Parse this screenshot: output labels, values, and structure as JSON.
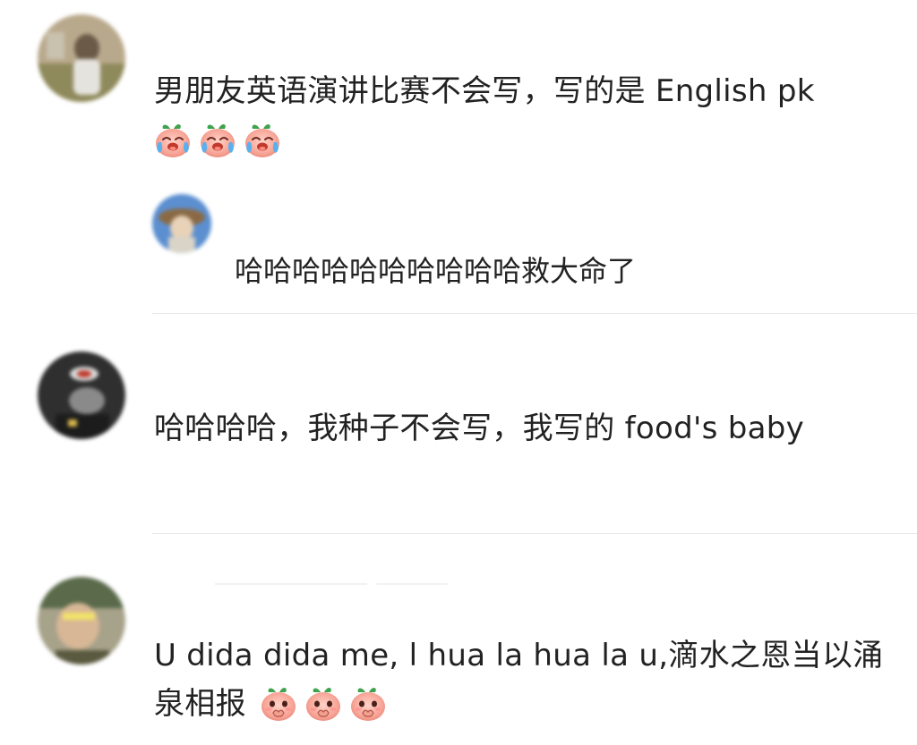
{
  "comments": [
    {
      "text": "男朋友英语演讲比赛不会写，写的是 English pk",
      "emoji": [
        "crying-laugh-peach-icon",
        "crying-laugh-peach-icon",
        "crying-laugh-peach-icon"
      ],
      "reply": {
        "text": "哈哈哈哈哈哈哈哈哈哈救大命了"
      }
    },
    {
      "text": "哈哈哈哈，我种子不会写，我写的 food's baby"
    },
    {
      "line1": "U dida dida me, l hua la hua la u,滴水之恩当以涌",
      "line2": "泉相报",
      "emoji": [
        "shy-peach-icon",
        "shy-peach-icon",
        "shy-peach-icon"
      ]
    }
  ],
  "colors": {
    "text": "#222222",
    "divider": "#e9e9e9",
    "peach": "#f4a39a",
    "leaf": "#3fa34d",
    "tear": "#5ab0ef"
  }
}
